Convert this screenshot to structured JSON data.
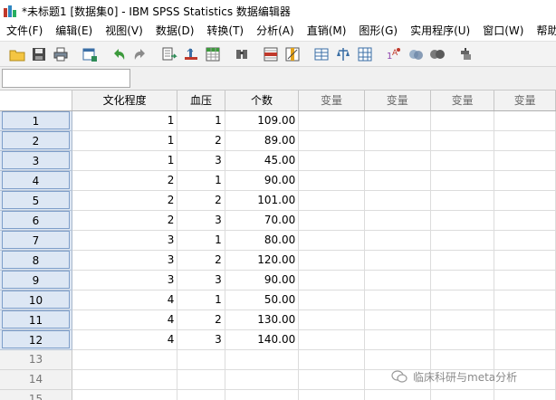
{
  "window": {
    "title": "*未标题1 [数据集0] - IBM SPSS Statistics 数据编辑器"
  },
  "menu": [
    "文件(F)",
    "编辑(E)",
    "视图(V)",
    "数据(D)",
    "转换(T)",
    "分析(A)",
    "直销(M)",
    "图形(G)",
    "实用程序(U)",
    "窗口(W)",
    "帮助"
  ],
  "toolbar": {
    "icons": [
      "open-icon",
      "save-icon",
      "print-icon",
      "dialog-recall-icon",
      "undo-icon",
      "redo-icon",
      "goto-case-icon",
      "goto-variable-icon",
      "variables-icon",
      "find-icon",
      "insert-case-icon",
      "insert-variable-icon",
      "split-file-icon",
      "weight-cases-icon",
      "select-cases-icon",
      "value-labels-icon",
      "use-sets-icon",
      "show-all-variables-icon",
      "spell-check-icon"
    ]
  },
  "grid": {
    "columns": [
      "文化程度",
      "血压",
      "个数",
      "变量",
      "变量",
      "变量",
      "变量"
    ],
    "rows": [
      {
        "num": "1",
        "cells": [
          "1",
          "1",
          "109.00"
        ]
      },
      {
        "num": "2",
        "cells": [
          "1",
          "2",
          "89.00"
        ]
      },
      {
        "num": "3",
        "cells": [
          "1",
          "3",
          "45.00"
        ]
      },
      {
        "num": "4",
        "cells": [
          "2",
          "1",
          "90.00"
        ]
      },
      {
        "num": "5",
        "cells": [
          "2",
          "2",
          "101.00"
        ]
      },
      {
        "num": "6",
        "cells": [
          "2",
          "3",
          "70.00"
        ]
      },
      {
        "num": "7",
        "cells": [
          "3",
          "1",
          "80.00"
        ]
      },
      {
        "num": "8",
        "cells": [
          "3",
          "2",
          "120.00"
        ]
      },
      {
        "num": "9",
        "cells": [
          "3",
          "3",
          "90.00"
        ]
      },
      {
        "num": "10",
        "cells": [
          "4",
          "1",
          "50.00"
        ]
      },
      {
        "num": "11",
        "cells": [
          "4",
          "2",
          "130.00"
        ]
      },
      {
        "num": "12",
        "cells": [
          "4",
          "3",
          "140.00"
        ]
      }
    ],
    "empty_rows": [
      "13",
      "14",
      "15"
    ]
  },
  "watermark": {
    "text": "临床科研与meta分析"
  }
}
